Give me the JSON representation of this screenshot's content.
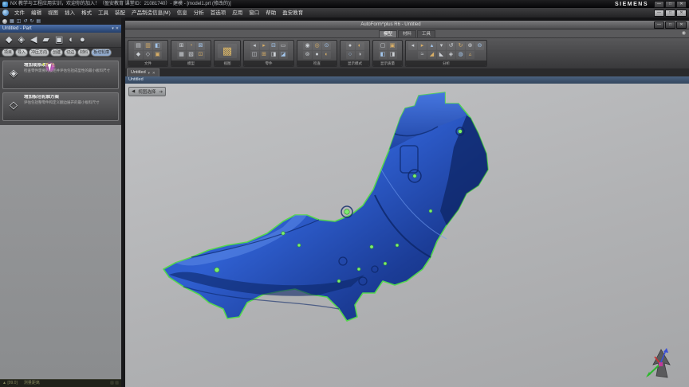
{
  "titlebar": {
    "app_title": "NX 教学与工程应用实训，欢迎你的加入！（盈安教育 课堂ID：21081740）- 建模 - [model1.prt (修改的)]",
    "brand": "SIEMENS",
    "controls": [
      "—",
      "□",
      "✕"
    ]
  },
  "menubar": {
    "items": [
      "文件",
      "编辑",
      "视图",
      "插入",
      "格式",
      "工具",
      "装配",
      "产品制造信息(M)",
      "信息",
      "分析",
      "首选项",
      "应用",
      "窗口",
      "帮助",
      "盈安教育"
    ],
    "controls": [
      "—",
      "□",
      "✕"
    ]
  },
  "left_panel": {
    "icon_row": [
      "▦",
      "◫",
      "↺",
      "↻",
      "▤"
    ],
    "part_title": "Untitled - Part",
    "title_buttons": [
      "▾",
      "✕"
    ],
    "big_icons": [
      "◆",
      "◈",
      "◀",
      "▰",
      "▣",
      "◐",
      "●"
    ],
    "pills": [
      "项目",
      "导入",
      "冲压方向",
      "创建",
      "切边",
      "材料",
      "板坯轮廓"
    ],
    "cards": [
      {
        "title_main": "增加或修改",
        "title_hl": "板坯",
        "desc": "检查零件需要的板坯并评估包括成型性的最小板料尺寸",
        "icon": "◈"
      },
      {
        "title_main": "增加板坯轮廓方案",
        "title_hl": "",
        "desc": "评估包括整零件和定义翻边展开的最小板料尺寸",
        "icon": "◇"
      }
    ],
    "bottom_left": "▲ [99.0]",
    "bottom_mid": "测量距离",
    "bottom_blocks": "▥ ▥"
  },
  "autoform": {
    "window_title": "AutoForm^plus R6 - Untitled",
    "controls": [
      "—",
      "□",
      "✕"
    ],
    "tabs": [
      {
        "label": "模型",
        "active": true
      },
      {
        "label": "材料",
        "active": false
      },
      {
        "label": "工具",
        "active": false
      }
    ],
    "help_icon": "◉",
    "toolbar_groups": [
      {
        "label": "文件",
        "icons": [
          "▤",
          "▥",
          "◧",
          "◆",
          "◇",
          "▣"
        ]
      },
      {
        "label": "模型",
        "icons": [
          "⊞",
          "◔",
          "⊠",
          "▦",
          "▧",
          "⊡"
        ]
      },
      {
        "label": "视图",
        "icons": [
          "▩"
        ]
      },
      {
        "label": "零件",
        "icons": [
          "◂",
          "▸",
          "⊟",
          "▭",
          "◫",
          "⊞",
          "◨",
          "◪"
        ]
      },
      {
        "label": "检查",
        "icons": [
          "◉",
          "◎",
          "⊙",
          "⊚",
          "●",
          "◐"
        ]
      },
      {
        "label": "显示模式",
        "icons": [
          "●",
          "◐",
          "○",
          "◑"
        ]
      },
      {
        "label": "显示质量",
        "icons": [
          "▢",
          "▣",
          "◧",
          "◨"
        ]
      },
      {
        "label": "分析",
        "icons": [
          "◂",
          "▸",
          "▴",
          "▾",
          "↺",
          "↻",
          "⊕",
          "⊖",
          "≈",
          "◢",
          "◣",
          "◈",
          "◍",
          "▵"
        ]
      }
    ],
    "doc_tab": {
      "label": "Untitled",
      "menu": "▾",
      "close": "✕"
    },
    "view_label": "Untitled",
    "view_selector": {
      "collapse": "◀",
      "label": "视图选择",
      "arrow": "➔"
    }
  },
  "colors": {
    "part_fill_light": "#3f6fd8",
    "part_fill_dark": "#122c74",
    "part_outline_green": "#54d74e",
    "hole_dot_green": "#7ded6e",
    "cursor_highlight": "#ff5bff",
    "titlebar_blue": "#4d70aa"
  }
}
